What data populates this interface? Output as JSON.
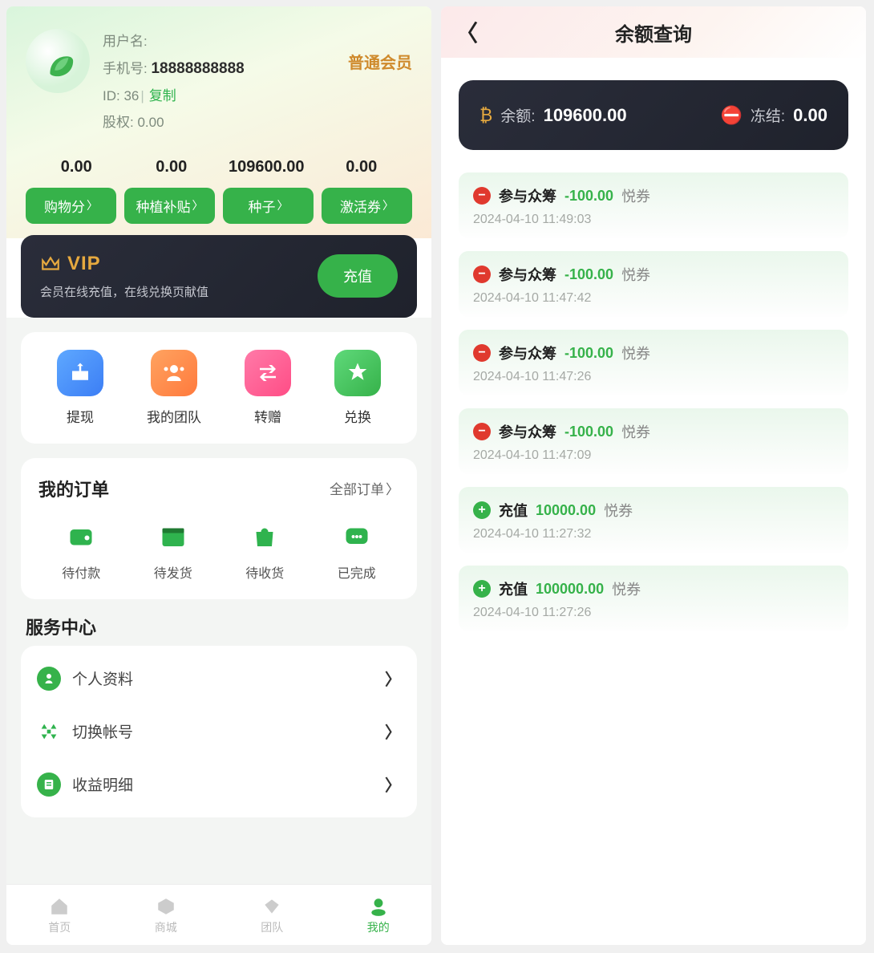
{
  "left": {
    "user": {
      "username_label": "用户名:",
      "phone_label": "手机号:",
      "phone": "18888888888",
      "id_label": "ID:",
      "id": "36",
      "copy": "复制",
      "equity_label": "股权:",
      "equity": "0.00",
      "member_level": "普通会员"
    },
    "stats": [
      {
        "value": "0.00",
        "label": "购物分"
      },
      {
        "value": "0.00",
        "label": "种植补贴"
      },
      {
        "value": "109600.00",
        "label": "种子"
      },
      {
        "value": "0.00",
        "label": "激活券"
      }
    ],
    "vip": {
      "title": "VIP",
      "subtitle": "会员在线充值，在线兑换页献值",
      "button": "充值"
    },
    "actions": [
      {
        "label": "提现"
      },
      {
        "label": "我的团队"
      },
      {
        "label": "转赠"
      },
      {
        "label": "兑换"
      }
    ],
    "orders": {
      "title": "我的订单",
      "all": "全部订单",
      "items": [
        {
          "label": "待付款"
        },
        {
          "label": "待发货"
        },
        {
          "label": "待收货"
        },
        {
          "label": "已完成"
        }
      ]
    },
    "service": {
      "title": "服务中心",
      "rows": [
        {
          "label": "个人资料"
        },
        {
          "label": "切换帐号"
        },
        {
          "label": "收益明细"
        }
      ]
    },
    "nav": [
      {
        "label": "首页"
      },
      {
        "label": "商城"
      },
      {
        "label": "团队"
      },
      {
        "label": "我的"
      }
    ]
  },
  "right": {
    "title": "余额查询",
    "balance": {
      "label": "余额:",
      "value": "109600.00",
      "frozen_label": "冻结:",
      "frozen": "0.00"
    },
    "txns": [
      {
        "type": "minus",
        "name": "参与众筹",
        "amount": "-100.00",
        "unit": "悦券",
        "time": "2024-04-10 11:49:03"
      },
      {
        "type": "minus",
        "name": "参与众筹",
        "amount": "-100.00",
        "unit": "悦券",
        "time": "2024-04-10 11:47:42"
      },
      {
        "type": "minus",
        "name": "参与众筹",
        "amount": "-100.00",
        "unit": "悦券",
        "time": "2024-04-10 11:47:26"
      },
      {
        "type": "minus",
        "name": "参与众筹",
        "amount": "-100.00",
        "unit": "悦券",
        "time": "2024-04-10 11:47:09"
      },
      {
        "type": "plus",
        "name": "充值",
        "amount": "10000.00",
        "unit": "悦券",
        "time": "2024-04-10 11:27:32"
      },
      {
        "type": "plus",
        "name": "充值",
        "amount": "100000.00",
        "unit": "悦券",
        "time": "2024-04-10 11:27:26"
      }
    ]
  }
}
